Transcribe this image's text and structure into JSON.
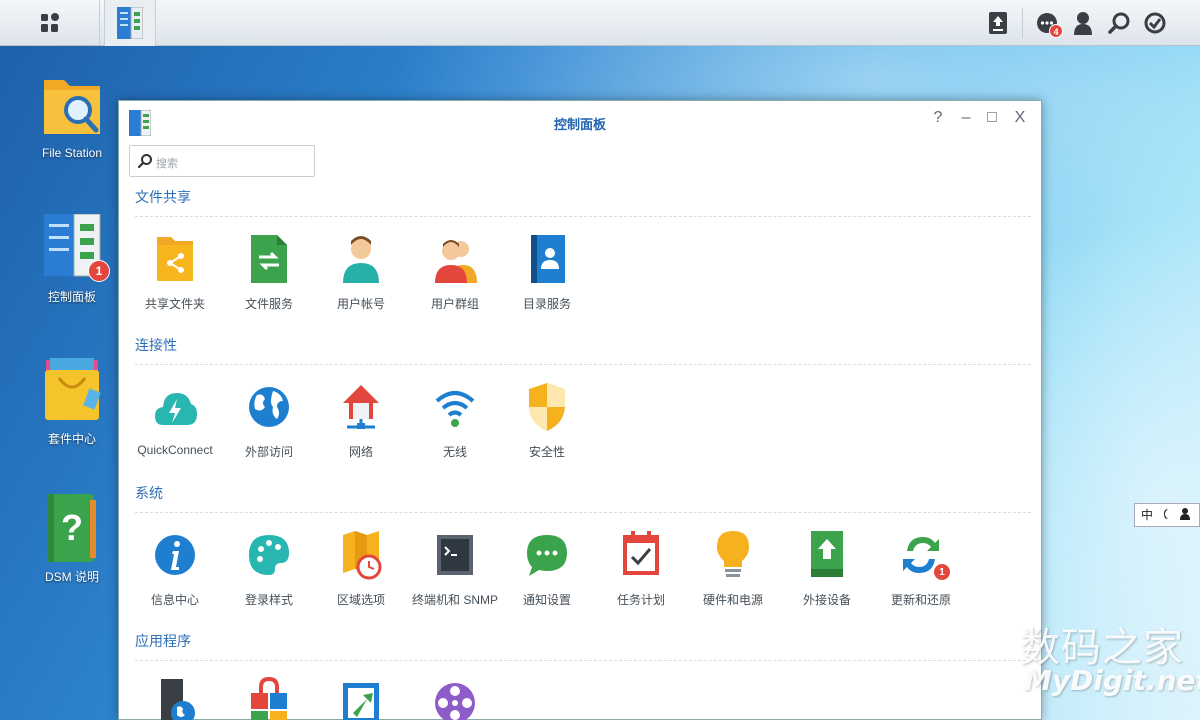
{
  "taskbar": {
    "main_menu_icon": "grid-icon",
    "active_app_icon": "control-panel-icon",
    "right_icons": [
      "upload-queue-icon",
      "notifications-icon",
      "user-icon",
      "search-icon",
      "widgets-icon"
    ],
    "notification_count": "4"
  },
  "desktop": {
    "icons": [
      {
        "label": "File Station",
        "icon": "folder-search-icon"
      },
      {
        "label": "控制面板",
        "icon": "control-panel-icon",
        "badge": "1"
      },
      {
        "label": "套件中心",
        "icon": "shopping-bag-icon"
      },
      {
        "label": "DSM 说明",
        "icon": "help-book-icon"
      }
    ]
  },
  "window": {
    "title": "控制面板",
    "controls": {
      "help": "?",
      "minimize": "–",
      "maximize": "□",
      "close": "X"
    },
    "search_placeholder": "搜索",
    "sections": [
      {
        "title": "文件共享",
        "items": [
          {
            "label": "共享文件夹",
            "icon": "shared-folder-icon"
          },
          {
            "label": "文件服务",
            "icon": "file-services-icon"
          },
          {
            "label": "用户帐号",
            "icon": "user-icon"
          },
          {
            "label": "用户群组",
            "icon": "group-icon"
          },
          {
            "label": "目录服务",
            "icon": "directory-icon"
          }
        ]
      },
      {
        "title": "连接性",
        "items": [
          {
            "label": "QuickConnect",
            "icon": "quickconnect-icon"
          },
          {
            "label": "外部访问",
            "icon": "globe-icon"
          },
          {
            "label": "网络",
            "icon": "network-house-icon"
          },
          {
            "label": "无线",
            "icon": "wifi-icon"
          },
          {
            "label": "安全性",
            "icon": "shield-icon"
          }
        ]
      },
      {
        "title": "系统",
        "items": [
          {
            "label": "信息中心",
            "icon": "info-icon"
          },
          {
            "label": "登录样式",
            "icon": "palette-icon"
          },
          {
            "label": "区域选项",
            "icon": "map-clock-icon"
          },
          {
            "label": "终端机和 SNMP",
            "icon": "terminal-icon"
          },
          {
            "label": "通知设置",
            "icon": "chat-bubble-icon"
          },
          {
            "label": "任务计划",
            "icon": "calendar-check-icon"
          },
          {
            "label": "硬件和电源",
            "icon": "lightbulb-icon"
          },
          {
            "label": "外接设备",
            "icon": "external-device-icon"
          },
          {
            "label": "更新和还原",
            "icon": "update-restore-icon",
            "badge": "1"
          }
        ]
      },
      {
        "title": "应用程序",
        "items": [
          {
            "label": "",
            "icon": "app-portal-icon"
          },
          {
            "label": "",
            "icon": "privileges-icon"
          },
          {
            "label": "",
            "icon": "shared-folder-sync-icon"
          },
          {
            "label": "",
            "icon": "media-indexing-icon"
          }
        ]
      }
    ]
  },
  "ime": {
    "text": "中"
  },
  "watermark": {
    "line1": "数码之家",
    "line2": "MyDigit.net"
  }
}
